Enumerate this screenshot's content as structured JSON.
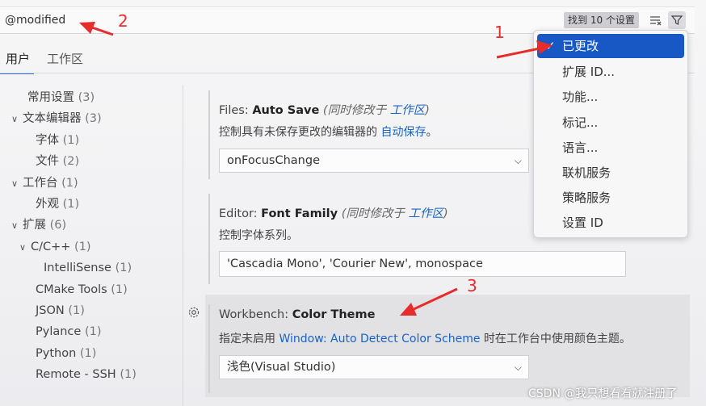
{
  "search": {
    "value": "@modified",
    "result_count": "找到 10 个设置"
  },
  "tabs": [
    {
      "label": "用户"
    },
    {
      "label": "工作区"
    }
  ],
  "tree": [
    {
      "label": "常用设置",
      "count": "(3)"
    },
    {
      "label": "文本编辑器",
      "count": "(3)"
    },
    {
      "label": "字体",
      "count": "(1)"
    },
    {
      "label": "文件",
      "count": "(2)"
    },
    {
      "label": "工作台",
      "count": "(1)"
    },
    {
      "label": "外观",
      "count": "(1)"
    },
    {
      "label": "扩展",
      "count": "(6)"
    },
    {
      "label": "C/C++",
      "count": "(1)"
    },
    {
      "label": "IntelliSense",
      "count": "(1)"
    },
    {
      "label": "CMake Tools",
      "count": "(1)"
    },
    {
      "label": "JSON",
      "count": "(1)"
    },
    {
      "label": "Pylance",
      "count": "(1)"
    },
    {
      "label": "Python",
      "count": "(1)"
    },
    {
      "label": "Remote - SSH",
      "count": "(1)"
    }
  ],
  "settings": [
    {
      "category": "Files: ",
      "name": "Auto Save",
      "note_prefix": "(同时修改于 ",
      "note_link": "工作区",
      "note_suffix": ")",
      "desc_prefix": "控制具有未保存更改的编辑器的 ",
      "desc_link": "自动保存",
      "desc_suffix": "。",
      "value": "onFocusChange"
    },
    {
      "category": "Editor: ",
      "name": "Font Family",
      "note_prefix": "(同时修改于 ",
      "note_link": "工作区",
      "note_suffix": ")",
      "desc": "控制字体系列。",
      "value": "'Cascadia Mono', 'Courier New', monospace"
    },
    {
      "category": "Workbench: ",
      "name": "Color Theme",
      "desc_prefix": "指定未启用 ",
      "desc_link": "Window: Auto Detect Color Scheme",
      "desc_suffix": " 时在工作台中使用颜色主题。",
      "value": "浅色(Visual Studio)"
    }
  ],
  "filter_menu": {
    "items": [
      {
        "label": "已更改",
        "selected": true
      },
      {
        "label": "扩展 ID..."
      },
      {
        "label": "功能..."
      },
      {
        "label": "标记..."
      },
      {
        "label": "语言..."
      },
      {
        "label": "联机服务"
      },
      {
        "label": "策略服务"
      },
      {
        "label": "设置 ID"
      }
    ]
  },
  "annotations": {
    "n1": "1",
    "n2": "2",
    "n3": "3"
  },
  "watermark": "CSDN @我只想看看就注册了",
  "colors": {
    "accent": "#1758c4",
    "link": "#1a62c4",
    "annotation": "#e82b2b"
  }
}
